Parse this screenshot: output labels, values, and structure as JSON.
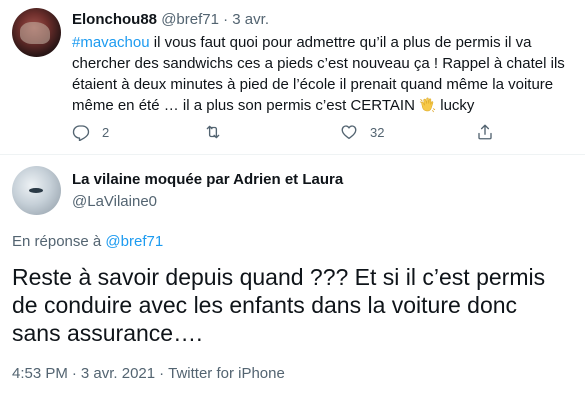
{
  "parent_tweet": {
    "author_name": "Elonchou88",
    "handle": "@bref71",
    "separator": "·",
    "date": "3 avr.",
    "hashtag": "#mavachou",
    "text_main": " il vous faut quoi pour admettre qu’il a plus de permis il va chercher des sandwichs ces a pieds c’est nouveau ça ! Rappel à chatel ils étaient à deux minutes à pied de l’école il prenait quand même la voiture même en été … il a plus son permis c’est CERTAIN ",
    "text_end": " lucky",
    "emoji": "waving-hand-emoji",
    "reply_count": "2",
    "retweet_count": "",
    "like_count": "32"
  },
  "main_tweet": {
    "author_name": "La vilaine moquée par Adrien et Laura",
    "handle": "@LaVilaine0",
    "reply_prefix": "En réponse à ",
    "reply_handle": "@bref71",
    "text": "Reste à savoir depuis quand ??? Et si il c’est permis de conduire avec les enfants dans la voiture donc sans assurance….",
    "time": "4:53 PM",
    "date": "3 avr. 2021",
    "source": "Twitter for iPhone",
    "separator": "·"
  },
  "colors": {
    "accent": "#1d9bf0",
    "secondary_text": "#536471",
    "primary_text": "#0f1419",
    "divider": "#eff3f4"
  },
  "icons": [
    "reply-icon",
    "retweet-icon",
    "like-icon",
    "share-icon"
  ]
}
